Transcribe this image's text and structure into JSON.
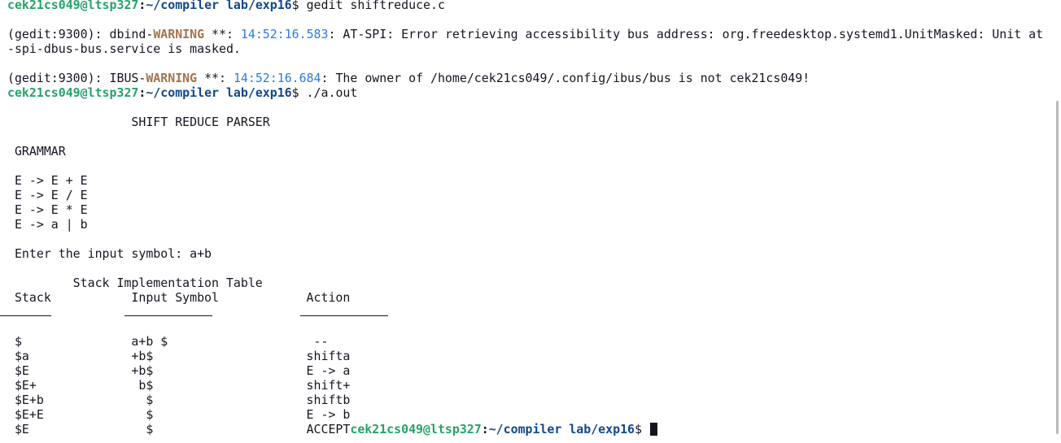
{
  "prompt": {
    "user_host": "cek21cs049@ltsp327",
    "colon": ":",
    "path": "~/compiler lab/exp16",
    "symbol": "$ "
  },
  "lines": {
    "cmd1": "gedit shiftreduce.c",
    "gedit_tag1": "(gedit:9300): dbind-",
    "warning1": "WARNING",
    "stars1": " **: ",
    "time1": "14:52:16.583",
    "msg1a": ": AT-SPI: Error retrieving accessibility bus address: org.freedesktop.systemd1.UnitMasked: Unit at",
    "msg1b": "-spi-dbus-bus.service is masked.",
    "gedit_tag2": "(gedit:9300): IBUS-",
    "warning2": "WARNING",
    "stars2": " **: ",
    "time2": "14:52:16.684",
    "msg2": ": The owner of /home/cek21cs049/.config/ibus/bus is not cek21cs049!",
    "cmd2": "./a.out",
    "title": "                 SHIFT REDUCE PARSER",
    "grammar_heading": " GRAMMAR",
    "grammar": [
      " E -> E + E",
      " E -> E / E",
      " E -> E * E",
      " E -> a | b"
    ],
    "input_prompt": " Enter the input symbol: a+b",
    "table_title": "         Stack Implementation Table",
    "table_header": " Stack           Input Symbol            Action",
    "rows": [
      " $               a+b $                    --",
      " $a              +b$                     shifta",
      " $E              +b$                     E -> a",
      " $E+              b$                     shift+",
      " $E+b              $                     shiftb",
      " $E+E              $                     E -> b",
      " $E                $                     "
    ],
    "accept": "ACCEPT"
  }
}
